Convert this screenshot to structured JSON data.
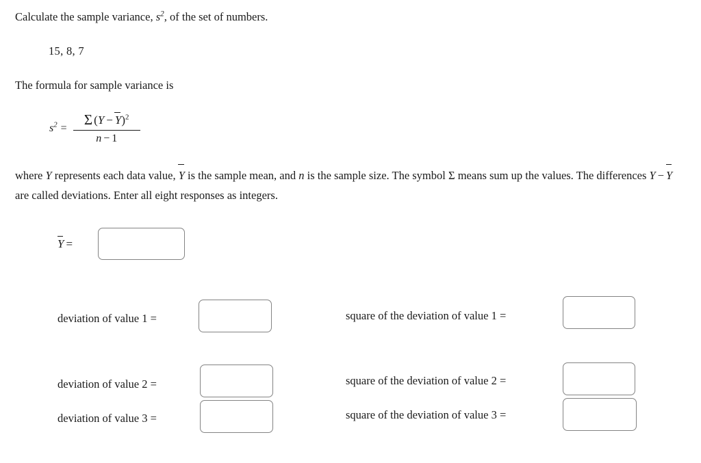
{
  "problem": {
    "prompt_before": "Calculate the sample variance, ",
    "prompt_symbol": "s",
    "prompt_exponent": "2",
    "prompt_after": ", of the set of numbers.",
    "numbers": "15, 8, 7",
    "formula_intro": "The formula for sample variance is"
  },
  "formula": {
    "lhs_symbol": "s",
    "lhs_exponent": "2",
    "equals": "=",
    "sigma": "Σ",
    "numerator_open": "(",
    "numerator_var": "Y",
    "numerator_minus": "−",
    "numerator_mean": "Y",
    "numerator_close": ")",
    "numerator_exponent": "2",
    "denominator_n": "n",
    "denominator_minus": "−",
    "denominator_one": "1"
  },
  "explanation": {
    "part1": "where ",
    "var_y": "Y",
    "part2": " represents each data value, ",
    "mean_y": "Y",
    "part3": " is the sample mean, and ",
    "var_n": "n",
    "part4": " is the sample size. The symbol ",
    "sigma": "Σ",
    "part5": " means sum up the values. The differences ",
    "diff_y": "Y",
    "minus": "−",
    "diff_mean": "Y",
    "part6": " are called deviations. Enter all eight responses as integers."
  },
  "inputs": {
    "mean_label_symbol": "Y",
    "mean_label_equals": "=",
    "mean_value": "",
    "mean_placeholder": "",
    "deviation_1_label": "deviation of value 1 =",
    "deviation_1_value": "",
    "deviation_2_label": "deviation of value 2 =",
    "deviation_2_value": "",
    "deviation_3_label": "deviation of value 3 =",
    "deviation_3_value": "",
    "square_1_label": "square of the deviation of value 1 =",
    "square_1_value": "",
    "square_2_label": "square of the deviation of value 2 =",
    "square_2_value": "",
    "square_3_label": "square of the deviation of value 3 =",
    "square_3_value": ""
  },
  "colors": {
    "background": "#ffffff",
    "text": "#1a1a1a",
    "input_border": "#838383"
  }
}
